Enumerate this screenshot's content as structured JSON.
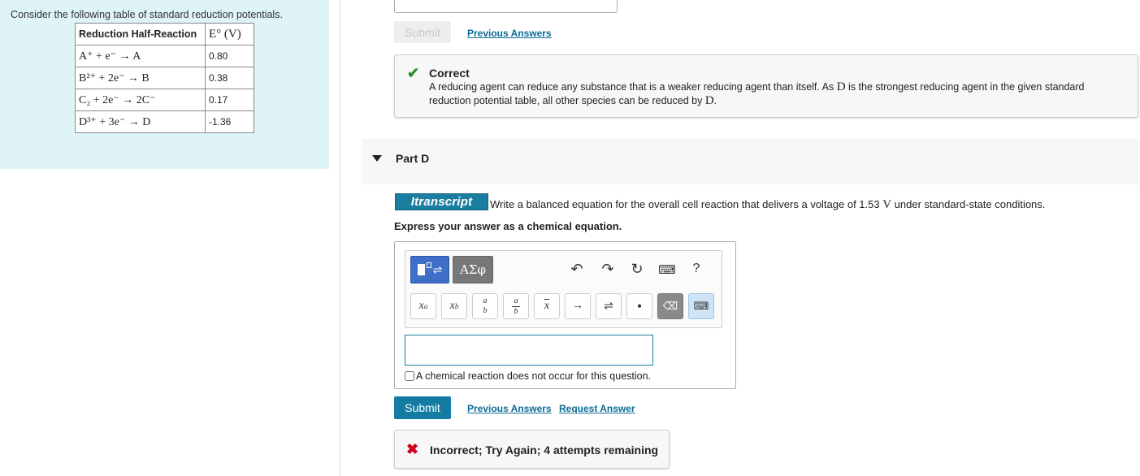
{
  "context": {
    "intro": "Consider the following table of standard reduction potentials.",
    "table": {
      "headers": [
        "Reduction Half-Reaction",
        "E° (V)"
      ],
      "rows": [
        {
          "reaction": "A⁺ + e⁻ → A",
          "value": "0.80"
        },
        {
          "reaction": "B²⁺ + 2e⁻ → B",
          "value": "0.38"
        },
        {
          "reaction": "C₂ + 2e⁻ → 2C⁻",
          "value": "0.17"
        },
        {
          "reaction": "D³⁺ + 3e⁻ → D",
          "value": "-1.36"
        }
      ]
    }
  },
  "part_c": {
    "submit_label": "Submit",
    "previous_answers_label": "Previous Answers",
    "feedback": {
      "title": "Correct",
      "text_1": "A reducing agent can reduce any substance that is a weaker reducing agent than itself. As ",
      "species_1": "D",
      "text_2": " is the strongest reducing agent in the given standard reduction potential table, all other species can be reduced by ",
      "species_2": "D",
      "text_3": "."
    }
  },
  "part_d": {
    "title": "Part D",
    "badge": "Itranscript",
    "question_1": "Write a balanced equation for the overall cell reaction that delivers a voltage of 1.53 ",
    "question_unit": "V",
    "question_2": " under standard-state conditions.",
    "instruction": "Express your answer as a chemical equation.",
    "editor": {
      "greek_button": "ΑΣφ",
      "keys": [
        "xᵃ",
        "x_b",
        "a/b",
        "a/b",
        "x̄",
        "→",
        "⇌",
        "•"
      ],
      "help": "?"
    },
    "answer_value": "",
    "no_reaction_label": "A chemical reaction does not occur for this question.",
    "submit_label": "Submit",
    "previous_answers_label": "Previous Answers",
    "request_answer_label": "Request Answer",
    "feedback": {
      "text": "Incorrect; Try Again; 4 attempts remaining"
    }
  },
  "colors": {
    "left_panel_bg": "#def4f7",
    "primary_button": "#147ca3",
    "link": "#0b6c96",
    "correct": "#2e8b2e",
    "incorrect": "#d0021b"
  }
}
